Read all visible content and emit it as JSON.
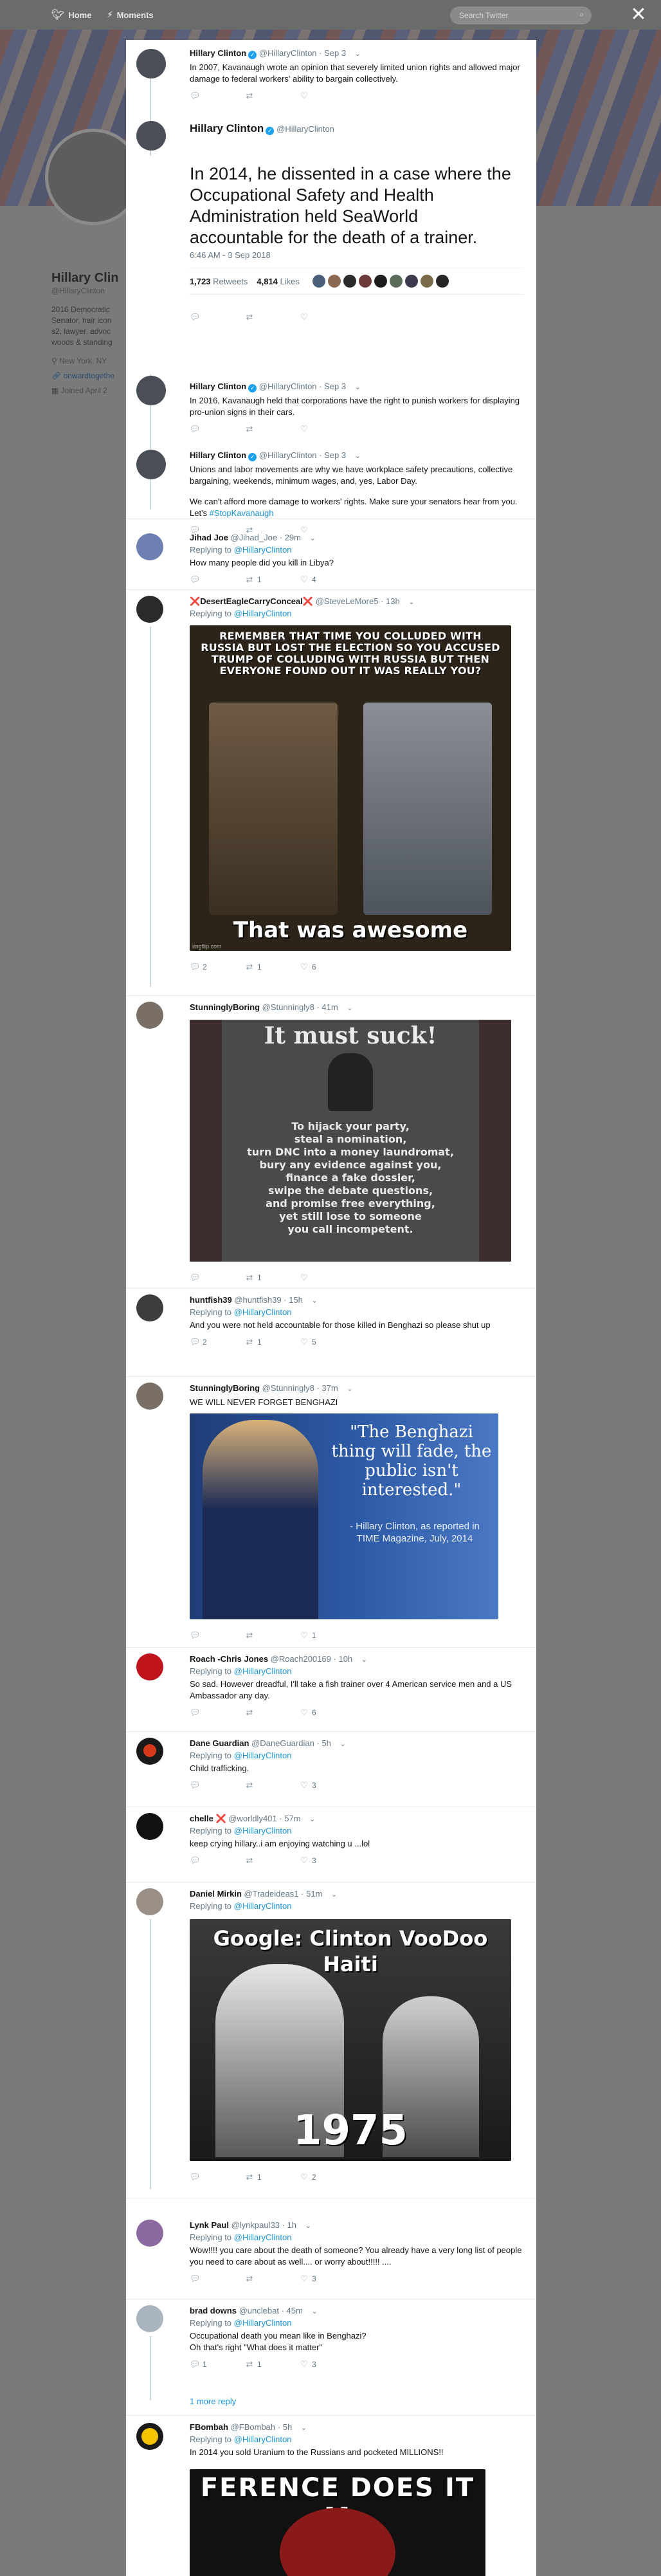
{
  "topnav": {
    "home_label": "Home",
    "moments_label": "Moments",
    "search_placeholder": "Search Twitter"
  },
  "profile": {
    "name": "Hillary Clin",
    "handle": "@HillaryClinton",
    "bio_lines": [
      "2016 Democratic",
      "Senator, hair icon",
      "s2, lawyer, advoc",
      "woods & standing"
    ],
    "location": "New York, NY",
    "website": "onwardtogethe",
    "joined": "Joined April 2"
  },
  "thread": [
    {
      "name": "Hillary Clinton",
      "handle": "@HillaryClinton",
      "time": "Sep 3",
      "text": "In 2007, Kavanaugh wrote an opinion that severely limited union rights and allowed major damage to federal workers' ability to bargain collectively."
    }
  ],
  "main_tweet": {
    "name": "Hillary Clinton",
    "handle": "@HillaryClinton",
    "text": "In 2014, he dissented in a case where the Occupational Safety and Health Administration held SeaWorld accountable for the death of a trainer.",
    "timestamp": "6:46 AM - 3 Sep 2018",
    "retweets": "1,723",
    "retweets_label": "Retweets",
    "likes": "4,814",
    "likes_label": "Likes"
  },
  "thread_after": [
    {
      "name": "Hillary Clinton",
      "handle": "@HillaryClinton",
      "time": "Sep 3",
      "text": "In 2016, Kavanaugh held that corporations have the right to punish workers for displaying pro-union signs in their cars."
    },
    {
      "name": "Hillary Clinton",
      "handle": "@HillaryClinton",
      "time": "Sep 3",
      "text": "Unions and labor movements are why we have workplace safety precautions, collective bargaining, weekends, minimum wages, and, yes, Labor Day.",
      "text2": "We can't afford more damage to workers' rights. Make sure your senators hear from you. Let's ",
      "hashtag": "#StopKavanaugh"
    }
  ],
  "reply_prefix": "Replying to",
  "reply_target": "@HillaryClinton",
  "replies": [
    {
      "name": "Jihad Joe",
      "handle": "@Jihad_Joe",
      "time": "29m",
      "text": "How many people did you kill in Libya?",
      "counts": [
        "",
        "1",
        "4"
      ]
    },
    {
      "name": "DesertEagleCarryConceal",
      "name_prefix": "❌",
      "name_suffix": "❌",
      "handle": "@SteveLeMore5",
      "time": "13h",
      "image": {
        "top_text": "Remember that time you colluded with Russia but lost the election so you accused Trump of colluding with Russia but then everyone found out it was really you?",
        "bottom_text": "That was awesome",
        "watermark": "imgflip.com"
      },
      "counts": [
        "2",
        "1",
        "6"
      ]
    },
    {
      "name": "StunninglyBoring",
      "handle": "@Stunningly8",
      "time": "41m",
      "image": {
        "title": "It must suck!",
        "lines": [
          "To hijack your party,",
          "steal a nomination,",
          "turn DNC into a money laundromat,",
          "bury any evidence against you,",
          "finance a fake dossier,",
          "swipe the debate questions,",
          "and promise free everything,",
          "yet still lose to someone",
          "you call incompetent."
        ]
      },
      "counts": [
        "",
        "1",
        ""
      ]
    },
    {
      "name": "huntfish39",
      "handle": "@huntfish39",
      "time": "15h",
      "text": "And you were not held accountable for those killed in Benghazi so please shut up",
      "counts": [
        "2",
        "1",
        "5"
      ]
    },
    {
      "name": "StunninglyBoring",
      "handle": "@Stunningly8",
      "time": "37m",
      "text": "WE WILL NEVER FORGET BENGHAZI",
      "image": {
        "quote": "\"The Benghazi thing will fade, the public isn't interested.\"",
        "attribution": "- Hillary Clinton, as reported in TIME Magazine, July, 2014"
      },
      "counts": [
        "",
        "",
        "1"
      ]
    },
    {
      "name": "Roach -Chris Jones",
      "handle": "@Roach200169",
      "time": "10h",
      "text": "So sad. However dreadful, I'll take a fish trainer over 4 American service men and a US Ambassador any day.",
      "counts": [
        "",
        "",
        "6"
      ]
    },
    {
      "name": "Dane Guardian",
      "handle": "@DaneGuardian",
      "time": "5h",
      "text": "Child trafficking.",
      "counts": [
        "",
        "",
        "3"
      ]
    },
    {
      "name": "chelle",
      "name_suffix": "❌",
      "handle": "@worldly401",
      "time": "57m",
      "text": "keep crying hillary..i am enjoying watching u ...lol",
      "counts": [
        "",
        "",
        "3"
      ]
    },
    {
      "name": "Daniel Mirkin",
      "handle": "@Tradeideas1",
      "time": "51m",
      "image": {
        "top_text": "Google: Clinton VooDoo Haiti",
        "bottom_text": "1975"
      },
      "counts": [
        "",
        "1",
        "2"
      ]
    },
    {
      "name": "Lynk Paul",
      "handle": "@lynkpaul33",
      "time": "1h",
      "text": "Wow!!!! you care about the death of someone? You already have a very long list of people you need to care about as well.... or worry about!!!!! ....",
      "counts": [
        "",
        "",
        "3"
      ]
    },
    {
      "name": "brad downs",
      "handle": "@unclebat",
      "time": "45m",
      "text": "Occupational death you mean like in Benghazi?",
      "text2": "Oh that's right \"What does it matter\"",
      "counts": [
        "1",
        "1",
        "3"
      ],
      "more_replies": "1 more reply"
    },
    {
      "name": "FBombah",
      "handle": "@FBombah",
      "time": "5h",
      "text": "In 2014 you sold Uranium to the Russians and pocketed MILLIONS!!",
      "image": {
        "top_text": "ference does it m"
      }
    }
  ],
  "colors": {
    "link": "#1b95e0",
    "verified": "#1da1f2",
    "muted": "#657786"
  }
}
